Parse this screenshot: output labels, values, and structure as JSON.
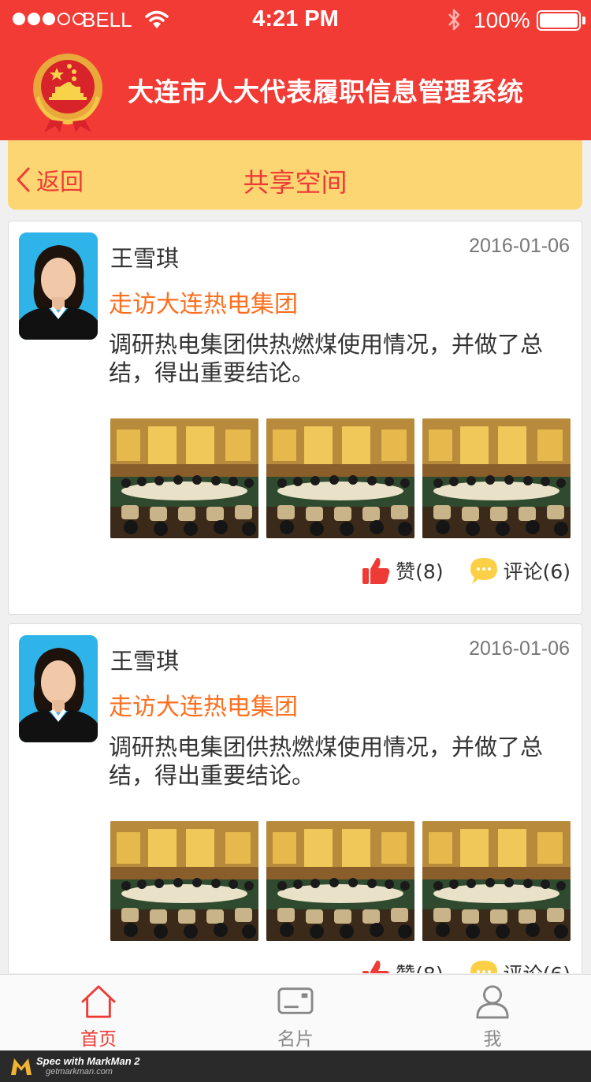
{
  "status_bar": {
    "carrier": "BELL",
    "time": "4:21 PM",
    "battery": "100%"
  },
  "header": {
    "title": "大连市人大代表履职信息管理系统",
    "emblem_icon": "national-emblem-icon"
  },
  "nav": {
    "back_label": "返回",
    "title": "共享空间"
  },
  "posts": [
    {
      "author": "王雪琪",
      "date": "2016-01-06",
      "title": "走访大连热电集团",
      "body": "调研热电集团供热燃煤使用情况，并做了总结，得出重要结论。",
      "like_label": "赞(8)",
      "comment_label": "评论(6)"
    },
    {
      "author": "王雪琪",
      "date": "2016-01-06",
      "title": "走访大连热电集团",
      "body": "调研热电集团供热燃煤使用情况，并做了总结，得出重要结论。",
      "like_label": "赞(8)",
      "comment_label": "评论(6)"
    }
  ],
  "tabs": [
    {
      "label": "首页",
      "icon": "home-icon",
      "active": true
    },
    {
      "label": "名片",
      "icon": "card-icon",
      "active": false
    },
    {
      "label": "我",
      "icon": "user-icon",
      "active": false
    }
  ],
  "watermark": {
    "brand": "Spec with MarkMan 2",
    "url": "getmarkman.com"
  },
  "colors": {
    "header_red": "#f23b35",
    "nav_yellow": "#fcd673",
    "title_orange": "#fe6f1e",
    "text_dark": "#333333",
    "like_red": "#ef3b35",
    "comment_yellow": "#fcd046"
  }
}
